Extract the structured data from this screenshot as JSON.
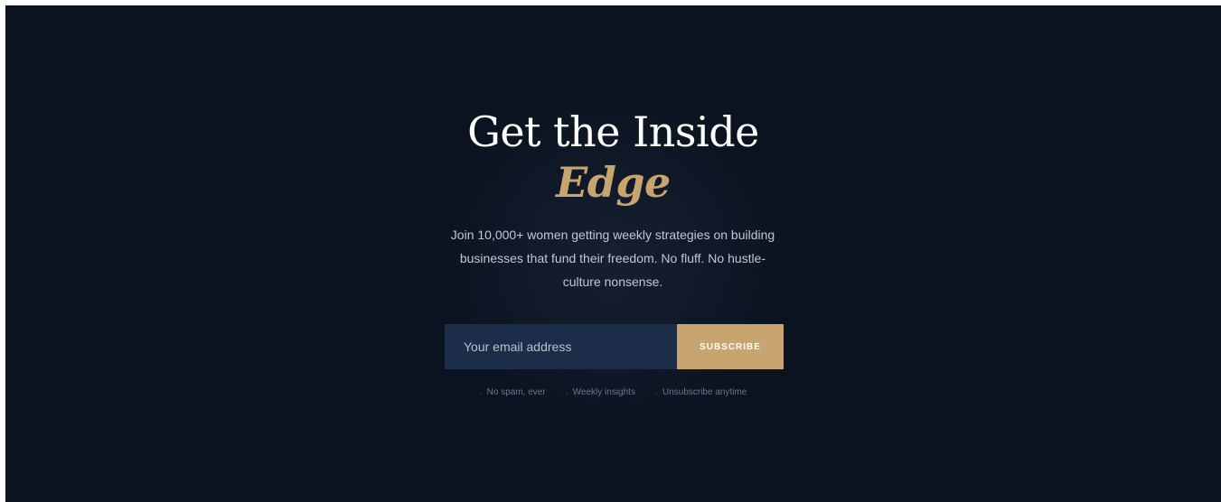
{
  "hero": {
    "headline": "Get the Inside",
    "headline_accent": "Edge",
    "subtext": "Join 10,000+ women getting weekly strategies on building businesses that fund their freedom. No fluff. No hustle-culture nonsense."
  },
  "form": {
    "email_placeholder": "Your email address",
    "email_value": "",
    "subscribe_label": "SUBSCRIBE"
  },
  "perks": [
    {
      "icon": "dot-icon",
      "label": "No spam, ever"
    },
    {
      "icon": "dot-icon",
      "label": "Weekly insights"
    },
    {
      "icon": "dot-icon",
      "label": "Unsubscribe anytime"
    }
  ],
  "colors": {
    "background": "#0b1320",
    "accent": "#c8a46e",
    "input_background": "#1c2d49"
  }
}
